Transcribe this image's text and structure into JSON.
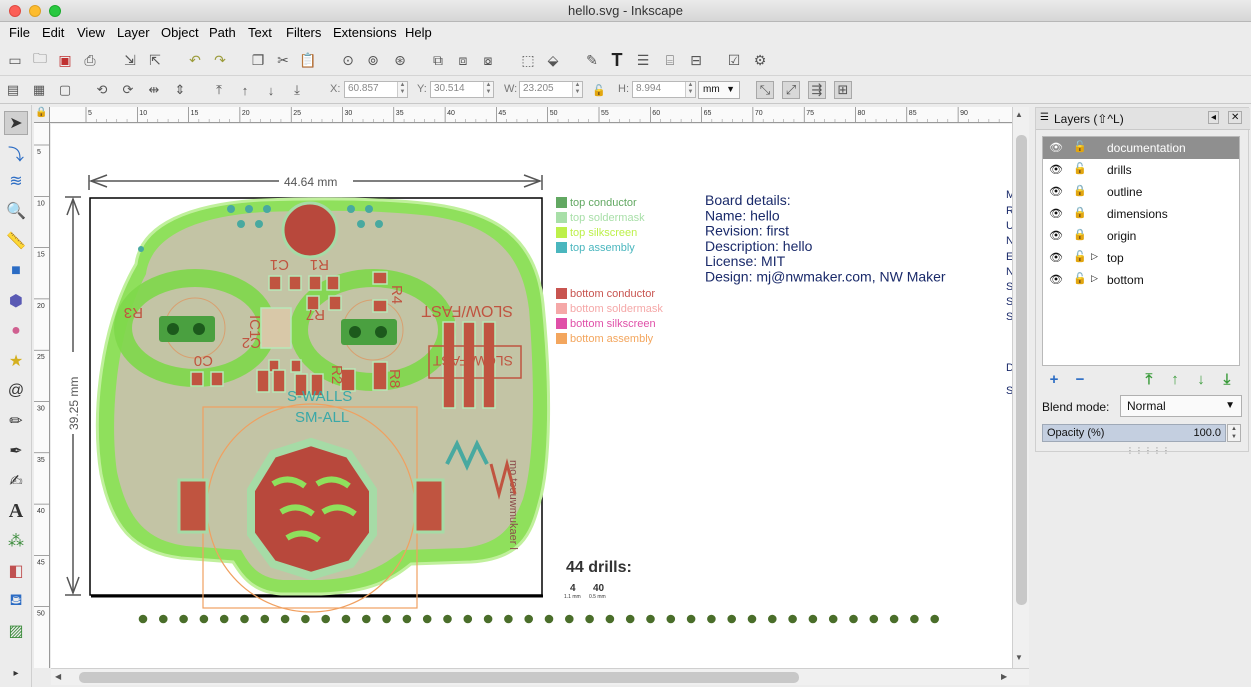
{
  "window": {
    "title": "hello.svg - Inkscape"
  },
  "menu": [
    "File",
    "Edit",
    "View",
    "Layer",
    "Object",
    "Path",
    "Text",
    "Filters",
    "Extensions",
    "Help"
  ],
  "toolbar": {
    "x_label": "X:",
    "x_value": "60.857",
    "y_label": "Y:",
    "y_value": "30.514",
    "w_label": "W:",
    "w_value": "23.205",
    "h_label": "H:",
    "h_value": "8.994",
    "unit": "mm"
  },
  "ruler": {
    "h_ticks": [
      "5",
      "10",
      "15",
      "20",
      "25",
      "30",
      "35",
      "40",
      "45",
      "50",
      "55",
      "60",
      "65",
      "70",
      "75",
      "80",
      "85",
      "90"
    ],
    "v_ticks": [
      "5",
      "10",
      "15",
      "20",
      "25",
      "30",
      "35",
      "40",
      "45",
      "50"
    ]
  },
  "canvas": {
    "dim_width": "44.64 mm",
    "dim_height": "39.25 mm",
    "legend_top": [
      {
        "label": "top conductor",
        "color": "#62a862"
      },
      {
        "label": "top soldermask",
        "color": "#a8dfa8"
      },
      {
        "label": "top silkscreen",
        "color": "#bdf04a"
      },
      {
        "label": "top assembly",
        "color": "#4ab6be"
      }
    ],
    "legend_bottom": [
      {
        "label": "bottom conductor",
        "color": "#c85450"
      },
      {
        "label": "bottom soldermask",
        "color": "#f5a8a8"
      },
      {
        "label": "bottom silkscreen",
        "color": "#e050a8"
      },
      {
        "label": "bottom assembly",
        "color": "#f3a65e"
      }
    ],
    "board_details": [
      "Board details:",
      "Name: hello",
      "Revision: first",
      "Description: hello",
      "License: MIT",
      "Design: mj@nwmaker.com, NW Maker"
    ],
    "edge_letters": [
      "M",
      "R",
      "U",
      "N",
      "E",
      "N",
      "S",
      "S",
      "S",
      "D",
      "S"
    ],
    "drills_title": "44 drills:",
    "drill_groups": [
      {
        "count": "4",
        "size": "1.1 mm"
      },
      {
        "count": "40",
        "size": "0.5 mm"
      }
    ],
    "silk_labels": {
      "c1": "C1",
      "r1": "R1",
      "r3": "R3",
      "r4": "R4",
      "r7": "R7",
      "ic1": "IC1",
      "c2": "C2",
      "c0": "C0",
      "r2": "R2",
      "r8": "R8",
      "slowfast": "SLOW/FAST",
      "swalls": "S-WALLS",
      "small": "SM-ALL",
      "nwmaker": "NWMaker",
      "llmt": "mo.teuuwmukaer l"
    },
    "hole_count": 40
  },
  "layers_panel": {
    "title": "Layers (⇧^L)",
    "layers": [
      {
        "name": "documentation",
        "selected": true,
        "locked": false,
        "expander": false
      },
      {
        "name": "drills",
        "selected": false,
        "locked": false,
        "expander": false
      },
      {
        "name": "outline",
        "selected": false,
        "locked": true,
        "expander": false
      },
      {
        "name": "dimensions",
        "selected": false,
        "locked": true,
        "expander": false
      },
      {
        "name": "origin",
        "selected": false,
        "locked": true,
        "expander": false
      },
      {
        "name": "top",
        "selected": false,
        "locked": false,
        "expander": true
      },
      {
        "name": "bottom",
        "selected": false,
        "locked": false,
        "expander": true
      }
    ],
    "blend_label": "Blend mode:",
    "blend_value": "Normal",
    "opacity_label": "Opacity (%)",
    "opacity_value": "100.0"
  },
  "icons": {
    "select": "select-arrow-icon",
    "node": "node-edit-icon",
    "tweak": "tweak-icon",
    "zoom": "zoom-icon",
    "measure": "measure-icon",
    "rect": "rectangle-icon",
    "box3d": "box3d-icon",
    "ellipse": "ellipse-icon",
    "star": "star-icon",
    "spiral": "spiral-icon",
    "pencil": "pencil-icon",
    "pen": "pen-icon",
    "calligraphy": "calligraphy-icon",
    "text": "text-icon",
    "spray": "spray-icon",
    "eraser": "eraser-icon",
    "bucket": "paint-bucket-icon",
    "gradient": "gradient-icon"
  }
}
